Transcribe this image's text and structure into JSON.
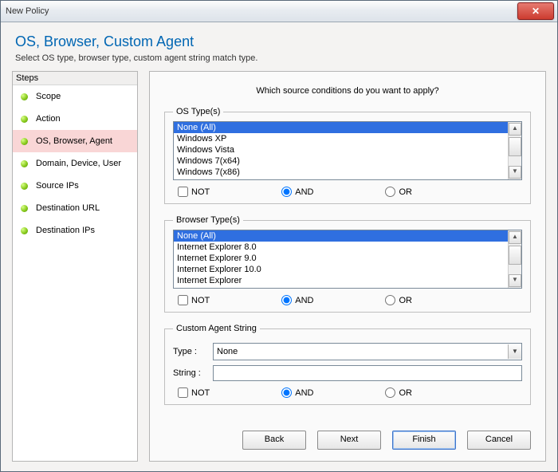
{
  "window": {
    "title": "New Policy"
  },
  "header": {
    "title": "OS, Browser, Custom Agent",
    "subtitle": "Select OS type, browser type, custom agent string match type."
  },
  "steps": {
    "header": "Steps",
    "items": [
      {
        "label": "Scope"
      },
      {
        "label": "Action"
      },
      {
        "label": "OS, Browser, Agent"
      },
      {
        "label": "Domain, Device, User"
      },
      {
        "label": "Source IPs"
      },
      {
        "label": "Destination URL"
      },
      {
        "label": "Destination IPs"
      }
    ]
  },
  "content": {
    "question": "Which source conditions do you want to apply?",
    "os": {
      "legend": "OS Type(s)",
      "items": [
        "None (All)",
        "Windows XP",
        "Windows Vista",
        "Windows 7(x64)",
        "Windows 7(x86)"
      ],
      "logic": {
        "not": "NOT",
        "and": "AND",
        "or": "OR"
      }
    },
    "browser": {
      "legend": "Browser Type(s)",
      "items": [
        "None (All)",
        "Internet Explorer 8.0",
        "Internet Explorer 9.0",
        "Internet Explorer 10.0",
        "Internet Explorer"
      ],
      "logic": {
        "not": "NOT",
        "and": "AND",
        "or": "OR"
      }
    },
    "custom": {
      "legend": "Custom Agent String",
      "type_label": "Type :",
      "type_value": "None",
      "string_label": "String :",
      "string_value": "",
      "logic": {
        "not": "NOT",
        "and": "AND",
        "or": "OR"
      }
    }
  },
  "buttons": {
    "back": "Back",
    "next": "Next",
    "finish": "Finish",
    "cancel": "Cancel"
  }
}
